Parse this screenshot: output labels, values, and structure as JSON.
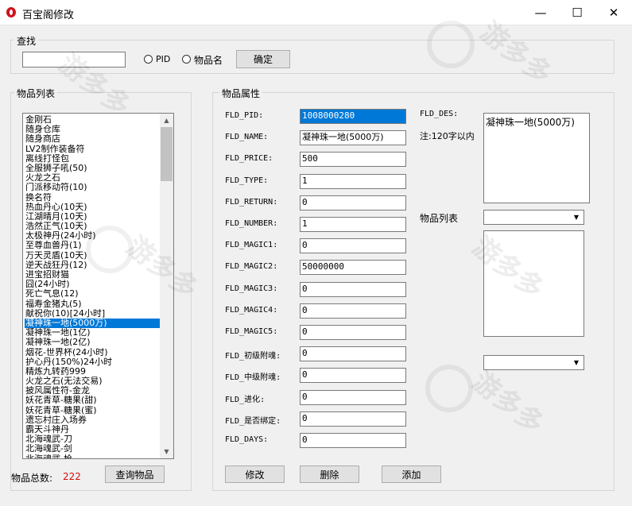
{
  "window": {
    "title": "百宝阁修改",
    "minimize": "—",
    "maximize": "☐",
    "close": "✕"
  },
  "search": {
    "group_title": "查找",
    "input_value": "",
    "radio_pid_label": "PID",
    "radio_name_label": "物品名",
    "confirm_button": "确定"
  },
  "item_list": {
    "group_title": "物品列表",
    "items": [
      "金刚石",
      "随身仓库",
      "随身商店",
      "LV2制作装备符",
      "离线打怪包",
      "全服狮子吼(50)",
      "火龙之石",
      "门派移动符(10)",
      "换名符",
      "热血丹心(10天)",
      "江湖晴月(10天)",
      "浩然正气(10天)",
      "太极神丹(24小时)",
      "至尊血兽丹(1)",
      "万天灵盾(10天)",
      "逆天战狂丹(12)",
      "进宝招财猫",
      "囧(24小时)",
      "死亡气息(12)",
      "福寿金猪丸(5)",
      "献祝你(10)[24小时]",
      "凝神珠一地(5000万)",
      "凝神珠一地(1亿)",
      "凝神珠一地(2亿)",
      "烟花-世界杯(24小时)",
      "护心丹(150%)24小时",
      "精炼九转药999",
      "火龙之石(无法交易)",
      "披风属性符-金龙",
      "妖花青草-糖果(甜)",
      "妖花青草-糖果(蜜)",
      "遗忘村庄入场券",
      "霸天斗神丹",
      "北海魂武-刀",
      "北海魂武-剑",
      "北海魂武-枪"
    ],
    "selected_index": 21,
    "count_label": "物品总数:",
    "count_value": "222",
    "query_button": "查询物品"
  },
  "properties": {
    "group_title": "物品属性",
    "fields": [
      {
        "label": "FLD_PID:",
        "value": "1008000280"
      },
      {
        "label": "FLD_NAME:",
        "value": "凝神珠一地(5000万)"
      },
      {
        "label": "FLD_PRICE:",
        "value": "500"
      },
      {
        "label": "FLD_TYPE:",
        "value": "1"
      },
      {
        "label": "FLD_RETURN:",
        "value": "0"
      },
      {
        "label": "FLD_NUMBER:",
        "value": "1"
      },
      {
        "label": "FLD_MAGIC1:",
        "value": "0"
      },
      {
        "label": "FLD_MAGIC2:",
        "value": "50000000"
      },
      {
        "label": "FLD_MAGIC3:",
        "value": "0"
      },
      {
        "label": "FLD_MAGIC4:",
        "value": "0"
      },
      {
        "label": "FLD_MAGIC5:",
        "value": "0"
      },
      {
        "label": "FLD_初级附魂:",
        "value": "0"
      },
      {
        "label": "FLD_中级附魂:",
        "value": "0"
      },
      {
        "label": "FLD_进化:",
        "value": "0"
      },
      {
        "label": "FLD_是否绑定:",
        "value": "0"
      },
      {
        "label": "FLD_DAYS:",
        "value": "0"
      }
    ],
    "des_label": "FLD_DES:",
    "des_note": "注:120字以内",
    "des_value": "凝神珠一地(5000万)",
    "list_label": "物品列表",
    "modify_button": "修改",
    "delete_button": "删除",
    "add_button": "添加"
  },
  "watermark": {
    "text": "游多多",
    "sub": "Youdd.Net"
  },
  "colors": {
    "selection": "#0078d7",
    "count": "#d01010",
    "window_bg": "#f0f0f0"
  }
}
